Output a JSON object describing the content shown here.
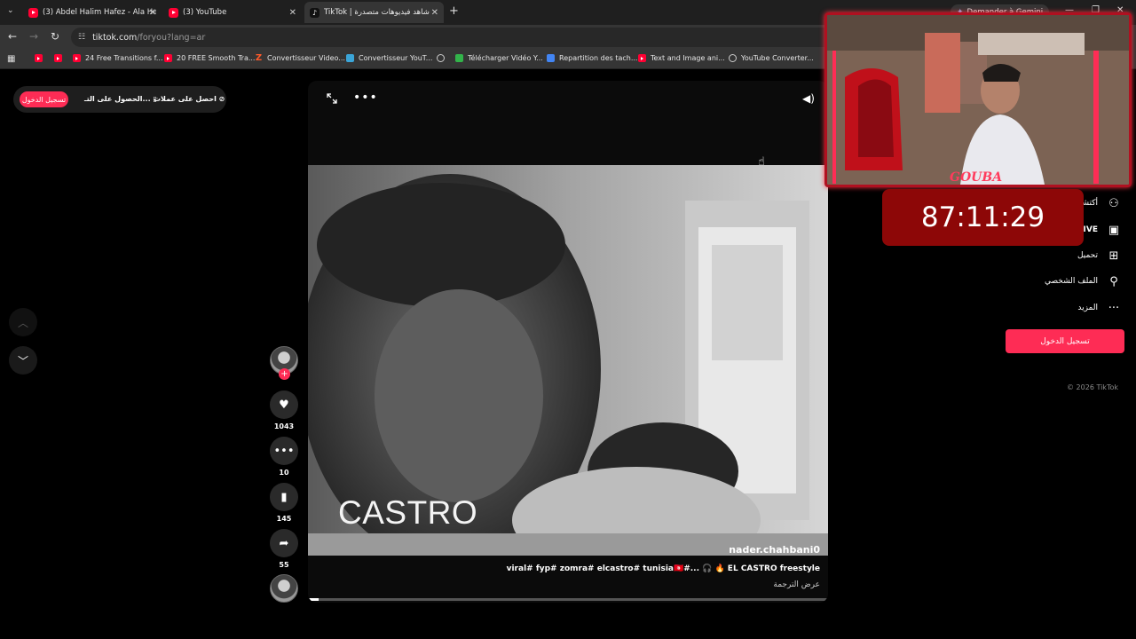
{
  "browser": {
    "tabs": [
      {
        "title": "(3) Abdel Halim Hafez - Ala He",
        "icon": "youtube-icon"
      },
      {
        "title": "(3) YouTube",
        "icon": "youtube-icon"
      },
      {
        "title": "شاهد فيديوهات متصدرة | TikTok",
        "icon": "tiktok-icon"
      }
    ],
    "gemini_label": "Demander à Gemini",
    "address": {
      "domain": "tiktok.com",
      "path": "/foryou?lang=ar"
    },
    "bookmarks": [
      {
        "label": "",
        "icon": "youtube-icon"
      },
      {
        "label": "",
        "icon": "youtube-icon"
      },
      {
        "label": "24 Free Transitions f...",
        "icon": "youtube-icon"
      },
      {
        "label": "20 FREE Smooth Tra...",
        "icon": "youtube-icon"
      },
      {
        "label": "Convertisseur Video...",
        "icon": "z-icon"
      },
      {
        "label": "Convertisseur YouT...",
        "icon": "converter-icon"
      },
      {
        "label": "",
        "icon": "globe-icon"
      },
      {
        "label": "Télécharger Vidéo Y...",
        "icon": "download-icon"
      },
      {
        "label": "Repartition des tach...",
        "icon": "docs-icon"
      },
      {
        "label": "Text and Image ani...",
        "icon": "youtube-icon"
      },
      {
        "label": "YouTube Converter...",
        "icon": "globe-icon"
      }
    ]
  },
  "topbar": {
    "login": "تسجيل الدخول",
    "get_app": "الحصول على التـ...",
    "get_coins": "احصل على عملات"
  },
  "video": {
    "caption_overlay": "CASTRO",
    "author": "nader.chahbani0",
    "description": "viral# fyp# zomra# elcastro# tunisia🇹🇳#... 🎧 🔥 EL CASTRO freestyle",
    "translate": "عرض الترجمة",
    "progress": 0.02
  },
  "actions": {
    "likes": "1043",
    "comments": "10",
    "saves": "145",
    "shares": "55"
  },
  "sidebar": {
    "items": [
      {
        "label": "أكتشف",
        "icon": "following-icon"
      },
      {
        "label": "LIVE",
        "icon": "live-icon"
      },
      {
        "label": "تحميل",
        "icon": "upload-icon"
      },
      {
        "label": "الملف الشخصي",
        "icon": "profile-icon"
      },
      {
        "label": "المزيد",
        "icon": "more-icon"
      }
    ],
    "login_button": "تسجيل الدخول",
    "copyright": "© 2026 TikTok"
  },
  "stream": {
    "timer": "87:11:29",
    "watermark": "GOUBA"
  },
  "colors": {
    "accent": "#fe2c55",
    "timer_bg": "#8d0707",
    "webcam_border": "#b01020"
  }
}
